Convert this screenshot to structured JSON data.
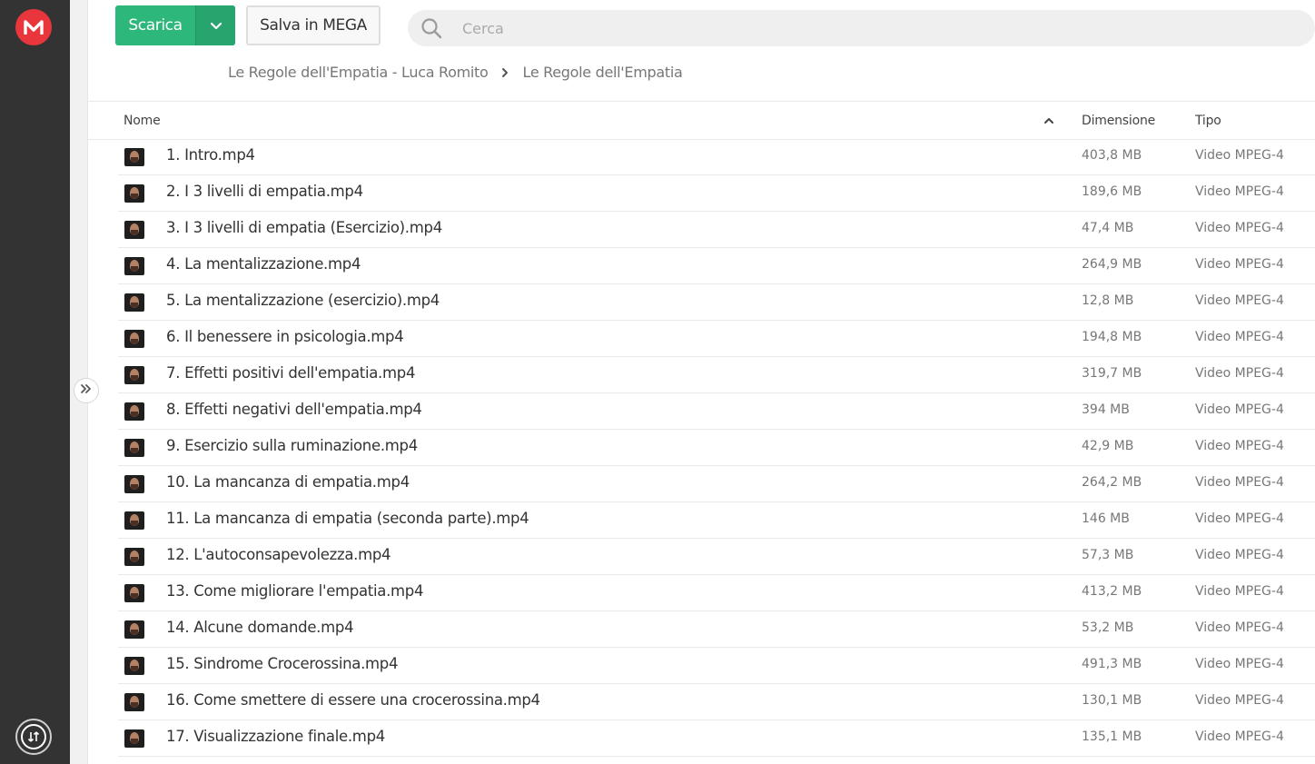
{
  "toolbar": {
    "download_label": "Scarica",
    "save_label": "Salva in MEGA",
    "search_placeholder": "Cerca"
  },
  "breadcrumb": [
    "Le Regole dell'Empatia - Luca Romito",
    "Le Regole dell'Empatia"
  ],
  "columns": {
    "name": "Nome",
    "size": "Dimensione",
    "type": "Tipo"
  },
  "files": [
    {
      "name": "1. Intro.mp4",
      "size": "403,8 MB",
      "type": "Video MPEG-4"
    },
    {
      "name": "2. I 3 livelli di empatia.mp4",
      "size": "189,6 MB",
      "type": "Video MPEG-4"
    },
    {
      "name": "3. I 3 livelli di empatia (Esercizio).mp4",
      "size": "47,4 MB",
      "type": "Video MPEG-4"
    },
    {
      "name": "4. La mentalizzazione.mp4",
      "size": "264,9 MB",
      "type": "Video MPEG-4"
    },
    {
      "name": "5. La mentalizzazione (esercizio).mp4",
      "size": "12,8 MB",
      "type": "Video MPEG-4"
    },
    {
      "name": "6. Il benessere in psicologia.mp4",
      "size": "194,8 MB",
      "type": "Video MPEG-4"
    },
    {
      "name": "7. Effetti positivi dell'empatia.mp4",
      "size": "319,7 MB",
      "type": "Video MPEG-4"
    },
    {
      "name": "8. Effetti negativi dell'empatia.mp4",
      "size": "394 MB",
      "type": "Video MPEG-4"
    },
    {
      "name": "9. Esercizio sulla ruminazione.mp4",
      "size": "42,9 MB",
      "type": "Video MPEG-4"
    },
    {
      "name": "10. La mancanza di empatia.mp4",
      "size": "264,2 MB",
      "type": "Video MPEG-4"
    },
    {
      "name": "11. La mancanza di empatia (seconda parte).mp4",
      "size": "146 MB",
      "type": "Video MPEG-4"
    },
    {
      "name": "12. L'autoconsapevolezza.mp4",
      "size": "57,3 MB",
      "type": "Video MPEG-4"
    },
    {
      "name": "13. Come migliorare l'empatia.mp4",
      "size": "413,2 MB",
      "type": "Video MPEG-4"
    },
    {
      "name": "14. Alcune domande.mp4",
      "size": "53,2 MB",
      "type": "Video MPEG-4"
    },
    {
      "name": "15. Sindrome Crocerossina.mp4",
      "size": "491,3 MB",
      "type": "Video MPEG-4"
    },
    {
      "name": "16. Come smettere di essere una crocerossina.mp4",
      "size": "130,1 MB",
      "type": "Video MPEG-4"
    },
    {
      "name": "17. Visualizzazione finale.mp4",
      "size": "135,1 MB",
      "type": "Video MPEG-4"
    }
  ],
  "icons": {
    "logo": "mega-logo-icon",
    "transfers": "transfers-icon",
    "expand": "chevron-double-right-icon",
    "download_dropdown": "chevron-down-icon",
    "search": "search-icon",
    "breadcrumb_separator": "chevron-right-icon",
    "sort": "chevron-up-icon",
    "thumbnail": "video-thumbnail-icon"
  },
  "colors": {
    "brand": "#e9363c",
    "accent": "#2eb77b",
    "sidebar": "#333333"
  }
}
